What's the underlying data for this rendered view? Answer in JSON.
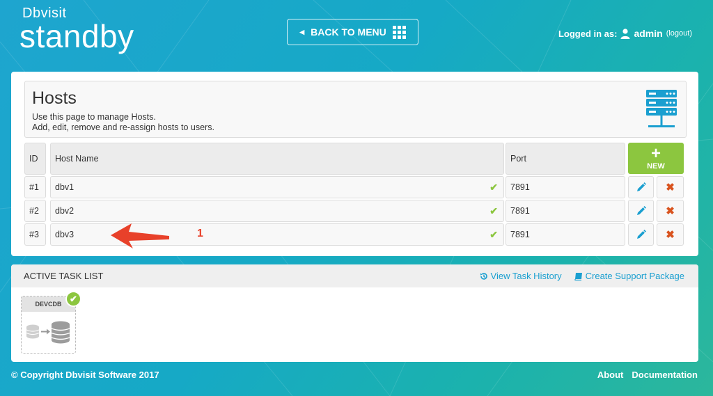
{
  "brand": {
    "small": "Dbvisit",
    "big": "standby"
  },
  "header": {
    "back_label": "BACK TO MENU",
    "logged_in_label": "Logged in as:",
    "username": "admin",
    "logout_label": "(logout)"
  },
  "hosts": {
    "title": "Hosts",
    "desc_line1": "Use this page to manage Hosts.",
    "desc_line2": "Add, edit, remove and re-assign hosts to users.",
    "columns": {
      "id": "ID",
      "host_name": "Host Name",
      "port": "Port"
    },
    "new_label": "NEW",
    "new_plus": "+",
    "rows": [
      {
        "id": "#1",
        "name": "dbv1",
        "port": "7891"
      },
      {
        "id": "#2",
        "name": "dbv2",
        "port": "7891"
      },
      {
        "id": "#3",
        "name": "dbv3",
        "port": "7891"
      }
    ]
  },
  "annotation": {
    "number": "1"
  },
  "tasks": {
    "title": "ACTIVE TASK LIST",
    "view_history": "View Task History",
    "support_package": "Create Support Package",
    "items": [
      {
        "name": "DEVCDB"
      }
    ]
  },
  "footer": {
    "copyright": "© Copyright Dbvisit Software 2017",
    "about": "About",
    "documentation": "Documentation"
  },
  "colors": {
    "accent_green": "#8cc63f",
    "link_blue": "#1a9fd0",
    "delete_orange": "#d9531e",
    "annotation_red": "#e8412a"
  }
}
